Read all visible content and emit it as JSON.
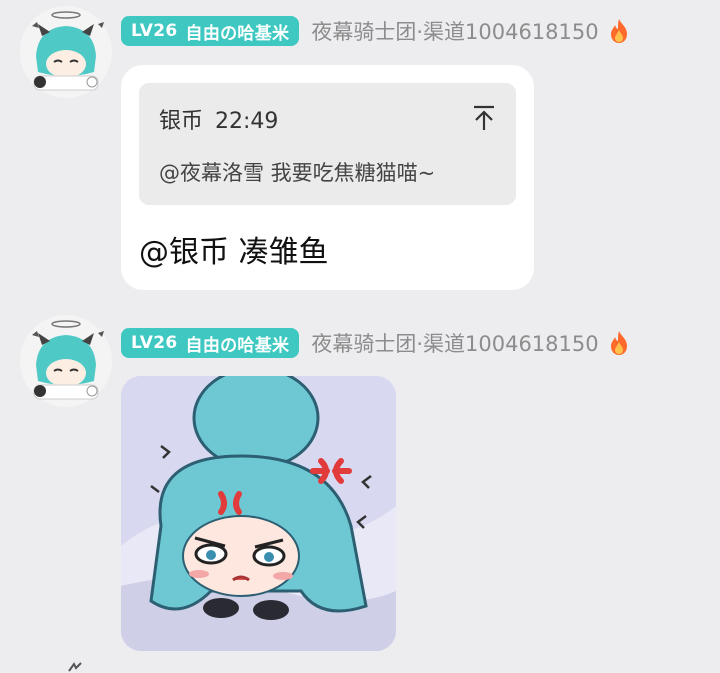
{
  "messages": [
    {
      "sender": {
        "level": "LV26",
        "nickname": "自由の哈基米",
        "group": "夜幕骑士团·渠道1004618150"
      },
      "quote": {
        "author": "银币",
        "time": "22:49",
        "text": "@夜幕洛雪  我要吃焦糖猫喵~"
      },
      "text": "@银币 凑雏鱼"
    },
    {
      "sender": {
        "level": "LV26",
        "nickname": "自由の哈基米",
        "group": "夜幕骑士团·渠道1004618150"
      },
      "sticker": "angry-chibi-sticker"
    }
  ],
  "colors": {
    "background": "#ededf0",
    "badge": "#3ec8c1",
    "bubble": "#ffffff",
    "quote": "#ebebeb",
    "fire": "#ff6a2b"
  },
  "icons": [
    "fire-icon",
    "scroll-up-icon"
  ]
}
